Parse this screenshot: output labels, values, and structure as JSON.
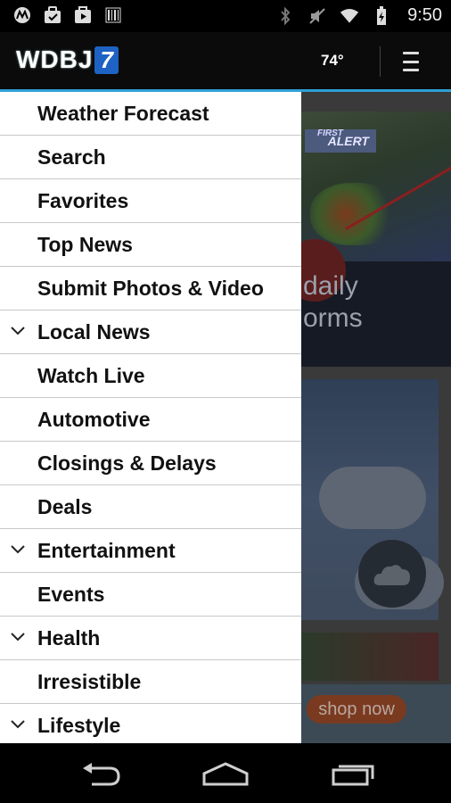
{
  "status_bar": {
    "time": "9:50",
    "left_icons": [
      "motorola-icon",
      "briefcase-icon",
      "play-store-icon",
      "barcode-icon"
    ],
    "right_icons": [
      "bluetooth-icon",
      "mute-icon",
      "wifi-icon",
      "battery-icon"
    ]
  },
  "app_bar": {
    "logo_text": "WDBJ",
    "logo_number": "7",
    "temperature": "74°",
    "menu_icon": "menu-icon",
    "accent_color": "#2fa0d7"
  },
  "drawer": {
    "items": [
      {
        "label": "Weather Forecast",
        "expandable": false
      },
      {
        "label": "Search",
        "expandable": false
      },
      {
        "label": "Favorites",
        "expandable": false
      },
      {
        "label": "Top News",
        "expandable": false
      },
      {
        "label": "Submit Photos & Video",
        "expandable": false
      },
      {
        "label": "Local News",
        "expandable": true
      },
      {
        "label": "Watch Live",
        "expandable": false
      },
      {
        "label": "Automotive",
        "expandable": false
      },
      {
        "label": "Closings & Delays",
        "expandable": false
      },
      {
        "label": "Deals",
        "expandable": false
      },
      {
        "label": "Entertainment",
        "expandable": true
      },
      {
        "label": "Events",
        "expandable": false
      },
      {
        "label": "Health",
        "expandable": true
      },
      {
        "label": "Irresistible",
        "expandable": false
      },
      {
        "label": "Lifestyle",
        "expandable": true
      }
    ]
  },
  "background": {
    "alert_badge": "ALERT",
    "alert_badge_top": "FIRST",
    "headline_partial": "daily\norms",
    "shop_button": "shop now"
  },
  "nav_bar": {
    "buttons": [
      "back-icon",
      "home-icon",
      "recent-apps-icon"
    ]
  }
}
